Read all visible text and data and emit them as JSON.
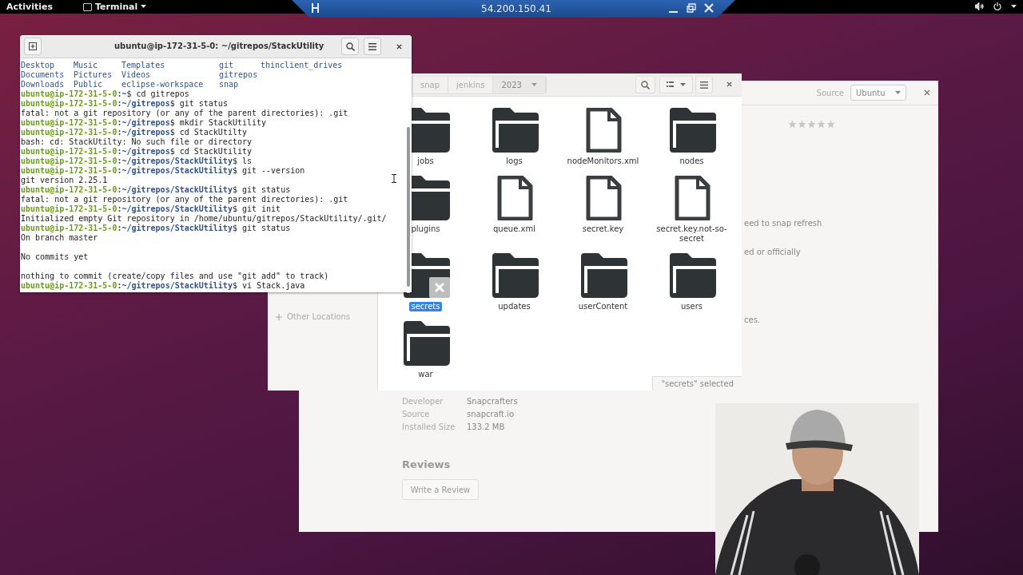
{
  "top_bar": {
    "activities": "Activities",
    "app_menu": "Terminal"
  },
  "remote_bar": {
    "title": "54.200.150.41"
  },
  "software_window": {
    "source_label": "Source",
    "source_value": "Ubuntu",
    "stars": 0,
    "fragments": [
      "eed to snap refresh",
      "ed or officially",
      "ces."
    ],
    "details": [
      {
        "label": "Developer",
        "value": "Snapcrafters"
      },
      {
        "label": "Source",
        "value": "snapcraft.io"
      },
      {
        "label": "Installed Size",
        "value": "133.2 MB"
      }
    ],
    "reviews_heading": "Reviews",
    "review_button": "Write a Review"
  },
  "files_window": {
    "path": [
      {
        "label": "snap",
        "selected": false
      },
      {
        "label": "jenkins",
        "selected": false
      },
      {
        "label": "2023",
        "selected": true
      }
    ],
    "sidebar": [
      {
        "label": "Other Locations",
        "kind": "add"
      }
    ],
    "items": [
      {
        "label": "jobs",
        "kind": "folder",
        "selected": false
      },
      {
        "label": "logs",
        "kind": "folder",
        "selected": false
      },
      {
        "label": "nodeMonitors.xml",
        "kind": "file",
        "selected": false
      },
      {
        "label": "nodes",
        "kind": "folder",
        "selected": false
      },
      {
        "label": "plugins",
        "kind": "folder",
        "selected": false
      },
      {
        "label": "queue.xml",
        "kind": "file",
        "selected": false
      },
      {
        "label": "secret.key",
        "kind": "file",
        "selected": false
      },
      {
        "label": "secret.key.not-so-secret",
        "kind": "file",
        "selected": false
      },
      {
        "label": "secrets",
        "kind": "folder",
        "selected": true,
        "cancel_overlay": true
      },
      {
        "label": "updates",
        "kind": "folder",
        "selected": false
      },
      {
        "label": "userContent",
        "kind": "folder",
        "selected": false
      },
      {
        "label": "users",
        "kind": "folder",
        "selected": false
      },
      {
        "label": "war",
        "kind": "folder",
        "selected": false
      }
    ],
    "status": "\"secrets\" selected"
  },
  "terminal": {
    "title": "ubuntu@ip-172-31-5-0: ~/gitrepos/StackUtility",
    "lines": [
      {
        "kind": "ls",
        "items": [
          "Desktop",
          "Music",
          "Templates",
          "git",
          "thinclient_drives"
        ]
      },
      {
        "kind": "ls",
        "items": [
          "Documents",
          "Pictures",
          "Videos",
          "gitrepos"
        ]
      },
      {
        "kind": "ls",
        "items": [
          "Downloads",
          "Public",
          "eclipse-workspace",
          "snap"
        ]
      },
      {
        "kind": "prompt",
        "user": "ubuntu@ip-172-31-5-0",
        "path": ":~",
        "command": "$ cd gitrepos"
      },
      {
        "kind": "prompt",
        "user": "ubuntu@ip-172-31-5-0",
        "path": ":~/gitrepos",
        "command": "$ git status"
      },
      {
        "kind": "output",
        "text": "fatal: not a git repository (or any of the parent directories): .git"
      },
      {
        "kind": "prompt",
        "user": "ubuntu@ip-172-31-5-0",
        "path": ":~/gitrepos",
        "command": "$ mkdir StackUtility"
      },
      {
        "kind": "prompt",
        "user": "ubuntu@ip-172-31-5-0",
        "path": ":~/gitrepos",
        "command": "$ cd StackUtilty"
      },
      {
        "kind": "output",
        "text": "bash: cd: StackUtilty: No such file or directory"
      },
      {
        "kind": "prompt",
        "user": "ubuntu@ip-172-31-5-0",
        "path": ":~/gitrepos",
        "command": "$ cd StackUtility"
      },
      {
        "kind": "prompt",
        "user": "ubuntu@ip-172-31-5-0",
        "path": ":~/gitrepos/StackUtility",
        "command": "$ ls"
      },
      {
        "kind": "prompt",
        "user": "ubuntu@ip-172-31-5-0",
        "path": ":~/gitrepos/StackUtility",
        "command": "$ git --version"
      },
      {
        "kind": "output",
        "text": "git version 2.25.1"
      },
      {
        "kind": "prompt",
        "user": "ubuntu@ip-172-31-5-0",
        "path": ":~/gitrepos/StackUtility",
        "command": "$ git status"
      },
      {
        "kind": "output",
        "text": "fatal: not a git repository (or any of the parent directories): .git"
      },
      {
        "kind": "prompt",
        "user": "ubuntu@ip-172-31-5-0",
        "path": ":~/gitrepos/StackUtility",
        "command": "$ git init"
      },
      {
        "kind": "output",
        "text": "Initialized empty Git repository in /home/ubuntu/gitrepos/StackUtility/.git/"
      },
      {
        "kind": "prompt",
        "user": "ubuntu@ip-172-31-5-0",
        "path": ":~/gitrepos/StackUtility",
        "command": "$ git status"
      },
      {
        "kind": "output",
        "text": "On branch master"
      },
      {
        "kind": "blank"
      },
      {
        "kind": "output",
        "text": "No commits yet"
      },
      {
        "kind": "blank"
      },
      {
        "kind": "output",
        "text": "nothing to commit (create/copy files and use \"git add\" to track)"
      },
      {
        "kind": "prompt",
        "user": "ubuntu@ip-172-31-5-0",
        "path": ":~/gitrepos/StackUtility",
        "command": "$ vi Stack.java"
      }
    ]
  }
}
